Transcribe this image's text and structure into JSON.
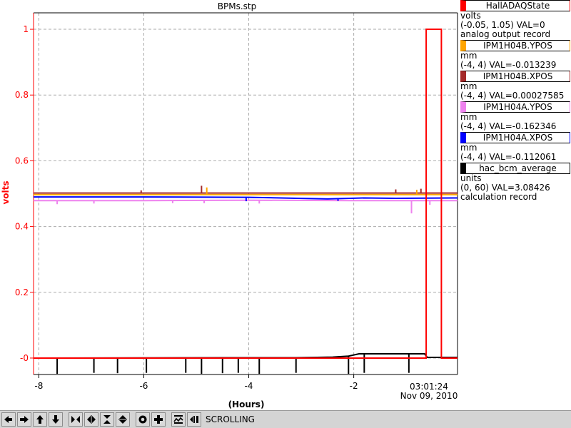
{
  "window": {
    "title": "BPMs.stp"
  },
  "chart_data": {
    "type": "line",
    "title": "BPMs.stp",
    "xlabel": "(Hours)",
    "ylabel": "volts",
    "xlim": [
      -8.1,
      -0.0233
    ],
    "ylim": [
      -0.05,
      1.05
    ],
    "x_ticks": [
      -8,
      -6,
      -4,
      -2
    ],
    "x_tick_labels": [
      "-8",
      "-6",
      "-4",
      "-2"
    ],
    "y_ticks": [
      0,
      0.2,
      0.4,
      0.6,
      0.8,
      1
    ],
    "y_tick_labels": [
      "-0",
      "0.2",
      "0.4",
      "0.6",
      "0.8",
      "1"
    ],
    "end_time": "03:01:24",
    "end_date": "Nov 09, 2010",
    "grid": true,
    "axis_color": "#ff0000",
    "series": [
      {
        "name": "IPM1H04A.YPOS",
        "color": "#ee82ee",
        "points": [
          [
            -8.1,
            0.479
          ],
          [
            -6,
            0.479
          ],
          [
            -4,
            0.48
          ],
          [
            -2,
            0.479
          ],
          [
            -0.023,
            0.479
          ]
        ],
        "spikes": [
          [
            -7.65,
            0.468
          ],
          [
            -6.95,
            0.47
          ],
          [
            -5.45,
            0.471
          ],
          [
            -4.85,
            0.471
          ],
          [
            -3.8,
            0.47
          ],
          [
            -0.9,
            0.44
          ],
          [
            -0.55,
            0.466
          ]
        ]
      },
      {
        "name": "IPM1H04A.XPOS",
        "color": "#0000ff",
        "points": [
          [
            -8.1,
            0.49
          ],
          [
            -6,
            0.49
          ],
          [
            -4.0,
            0.489
          ],
          [
            -2.5,
            0.484
          ],
          [
            -1.8,
            0.487
          ],
          [
            -1.2,
            0.486
          ],
          [
            -0.023,
            0.487
          ]
        ],
        "spikes": [
          [
            -4.05,
            0.477
          ],
          [
            -2.3,
            0.478
          ]
        ]
      },
      {
        "name": "IPM1H04B.XPOS",
        "color": "#a52a2a",
        "points": [
          [
            -8.1,
            0.502
          ],
          [
            -6,
            0.502
          ],
          [
            -4,
            0.502
          ],
          [
            -2,
            0.502
          ],
          [
            -0.023,
            0.502
          ]
        ],
        "spikes": [
          [
            -4.9,
            0.524
          ],
          [
            -6.05,
            0.51
          ],
          [
            -0.72,
            0.515
          ],
          [
            -1.2,
            0.513
          ]
        ]
      },
      {
        "name": "IPM1H04B.YPOS",
        "color": "#ffa500",
        "points": [
          [
            -8.1,
            0.497
          ],
          [
            -6,
            0.497
          ],
          [
            -4,
            0.497
          ],
          [
            -2,
            0.497
          ],
          [
            -0.023,
            0.497
          ]
        ],
        "spikes": [
          [
            -4.8,
            0.519
          ],
          [
            -0.8,
            0.512
          ]
        ]
      },
      {
        "name": "hac_bcm_average",
        "color": "#000000",
        "points": [
          [
            -8.1,
            0.0
          ],
          [
            -4.4,
            0.001
          ],
          [
            -3.1,
            0.001
          ],
          [
            -2.4,
            0.003
          ],
          [
            -2.1,
            0.006
          ],
          [
            -1.9,
            0.013
          ],
          [
            -0.65,
            0.013
          ],
          [
            -0.6,
            0.002
          ],
          [
            -0.3,
            0.002
          ],
          [
            -0.023,
            0.002
          ]
        ],
        "spikes": [
          [
            -7.65,
            -0.048
          ],
          [
            -6.95,
            -0.045
          ],
          [
            -6.5,
            -0.046
          ],
          [
            -5.95,
            -0.045
          ],
          [
            -5.2,
            -0.045
          ],
          [
            -4.9,
            -0.048
          ],
          [
            -4.5,
            -0.046
          ],
          [
            -4.2,
            -0.045
          ],
          [
            -3.8,
            -0.048
          ],
          [
            -3.1,
            -0.045
          ],
          [
            -2.1,
            -0.048
          ],
          [
            -1.8,
            -0.045
          ],
          [
            -0.95,
            -0.045
          ]
        ]
      },
      {
        "name": "HallADAQState",
        "color": "#ff0000",
        "points": [
          [
            -8.1,
            0
          ],
          [
            -0.62,
            0
          ],
          [
            -0.62,
            1
          ],
          [
            -0.33,
            1
          ],
          [
            -0.33,
            0
          ],
          [
            -0.023,
            0
          ]
        ],
        "spikes": []
      }
    ]
  },
  "legend": [
    {
      "name": "HallADAQState",
      "color": "#ff0000",
      "units": "volts",
      "range_val": "(-0.05, 1.05) VAL=0",
      "extra": "analog output record"
    },
    {
      "name": "IPM1H04B.YPOS",
      "color": "#ffa500",
      "units": "mm",
      "range_val": "(-4, 4) VAL=-0.013239",
      "extra": ""
    },
    {
      "name": "IPM1H04B.XPOS",
      "color": "#a52a2a",
      "units": "mm",
      "range_val": "(-4, 4) VAL=0.00027585",
      "extra": ""
    },
    {
      "name": "IPM1H04A.YPOS",
      "color": "#ee82ee",
      "units": "mm",
      "range_val": "(-4, 4) VAL=-0.162346",
      "extra": ""
    },
    {
      "name": "IPM1H04A.XPOS",
      "color": "#0000ff",
      "units": "mm",
      "range_val": "(-4, 4) VAL=-0.112061",
      "extra": ""
    },
    {
      "name": "hac_bcm_average",
      "color": "#000000",
      "units": "units",
      "range_val": "(0, 60) VAL=3.08426",
      "extra": "calculation record"
    }
  ],
  "toolbar": {
    "buttons": [
      {
        "icon": "pan-left-icon"
      },
      {
        "icon": "pan-right-icon"
      },
      {
        "icon": "pan-up-icon"
      },
      {
        "icon": "pan-down-icon"
      },
      {
        "icon": "zoom-in-x-icon"
      },
      {
        "icon": "zoom-out-x-icon"
      },
      {
        "icon": "zoom-in-y-icon"
      },
      {
        "icon": "zoom-out-y-icon"
      },
      {
        "icon": "reset-icon"
      },
      {
        "icon": "crosshair-icon"
      },
      {
        "icon": "autoscale-icon"
      },
      {
        "icon": "scroll-mode-icon"
      }
    ],
    "status": "SCROLLING"
  }
}
